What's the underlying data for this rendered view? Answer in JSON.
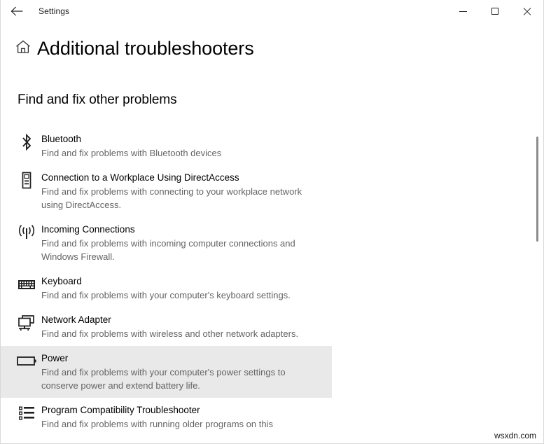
{
  "window": {
    "app_title": "Settings",
    "back_icon": "back-arrow-icon",
    "minimize_label": "Minimize",
    "maximize_label": "Maximize",
    "close_label": "Close"
  },
  "header": {
    "home_icon": "home-icon",
    "page_title": "Additional troubleshooters"
  },
  "section": {
    "title": "Find and fix other problems"
  },
  "troubleshooters": [
    {
      "icon": "bluetooth-icon",
      "name": "Bluetooth",
      "description": "Find and fix problems with Bluetooth devices"
    },
    {
      "icon": "directaccess-device-icon",
      "name": "Connection to a Workplace Using DirectAccess",
      "description": "Find and fix problems with connecting to your workplace network using DirectAccess."
    },
    {
      "icon": "broadcast-antenna-icon",
      "name": "Incoming Connections",
      "description": "Find and fix problems with incoming computer connections and Windows Firewall."
    },
    {
      "icon": "keyboard-icon",
      "name": "Keyboard",
      "description": "Find and fix problems with your computer's keyboard settings."
    },
    {
      "icon": "network-adapter-icon",
      "name": "Network Adapter",
      "description": "Find and fix problems with wireless and other network adapters."
    },
    {
      "icon": "battery-icon",
      "name": "Power",
      "description": "Find and fix problems with your computer's power settings to conserve power and extend battery life.",
      "selected": true
    },
    {
      "icon": "list-icon",
      "name": "Program Compatibility Troubleshooter",
      "description": "Find and fix problems with running older programs on this"
    }
  ],
  "scrollbar": {
    "name": "vertical-scrollbar"
  },
  "watermark": {
    "text": "wsxdn.com"
  },
  "colors": {
    "selected_row": "#e9e9e9",
    "description_text": "#646464",
    "scrollbar_thumb": "#8c8c8c"
  }
}
